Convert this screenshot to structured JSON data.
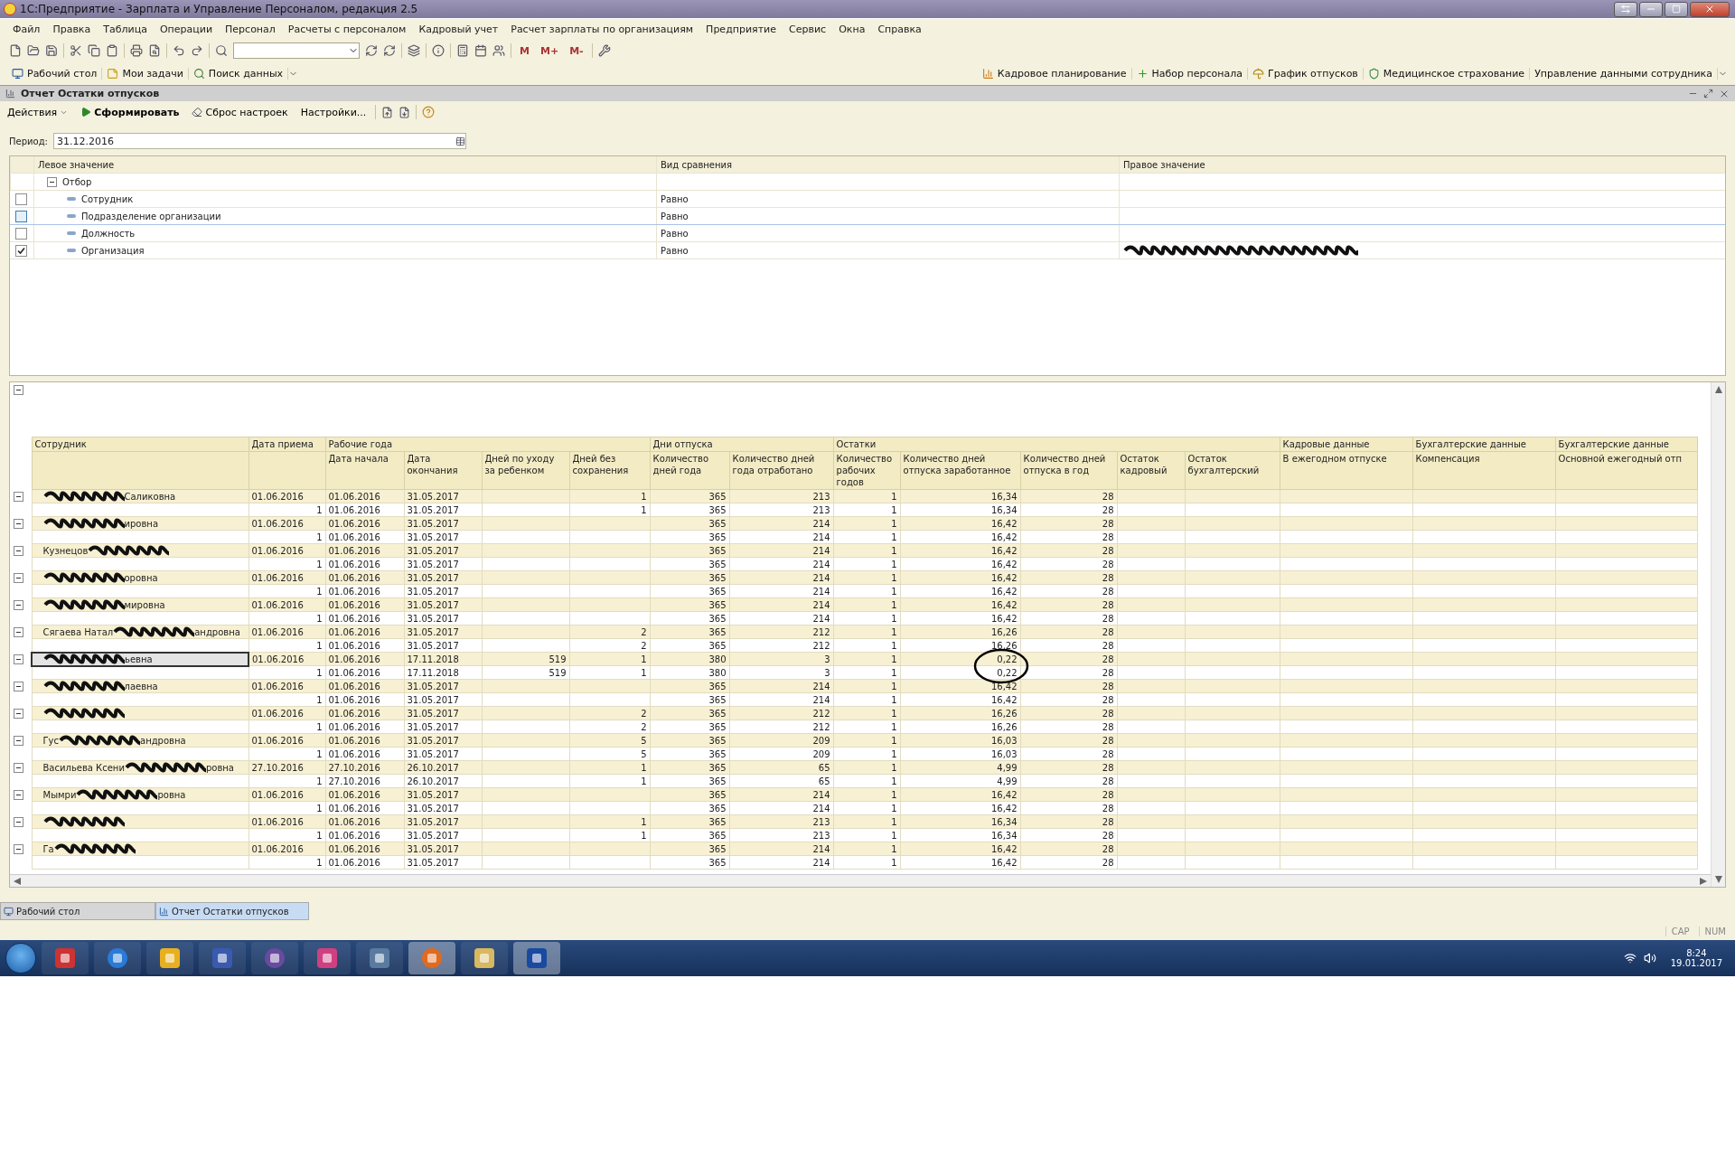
{
  "window": {
    "title": "1С:Предприятие - Зарплата и Управление Персоналом, редакция 2.5"
  },
  "menu": [
    "Файл",
    "Правка",
    "Таблица",
    "Операции",
    "Персонал",
    "Расчеты с персоналом",
    "Кадровый учет",
    "Расчет зарплаты по организациям",
    "Предприятие",
    "Сервис",
    "Окна",
    "Справка"
  ],
  "memory_buttons": [
    "M",
    "M+",
    "M-"
  ],
  "panel_left": [
    {
      "label": "Рабочий стол",
      "kind": "desk"
    },
    {
      "label": "Мои задачи",
      "kind": "note"
    },
    {
      "label": "Поиск данных",
      "kind": "search"
    }
  ],
  "panel_right": [
    {
      "label": "Кадровое планирование",
      "kind": "chart"
    },
    {
      "label": "Набор персонала",
      "kind": "plus"
    },
    {
      "label": "График отпусков",
      "kind": "umbrella"
    },
    {
      "label": "Медицинское страхование",
      "kind": "shield"
    },
    {
      "label": "Управление данными сотрудника",
      "kind": "none"
    }
  ],
  "document": {
    "title": "Отчет  Остатки отпусков",
    "actions": [
      {
        "label": "Действия",
        "kind": "menu"
      },
      {
        "label": "Сформировать",
        "kind": "run"
      },
      {
        "label": "Сброс настроек",
        "kind": "reset"
      },
      {
        "label": "Настройки...",
        "kind": "plain"
      }
    ],
    "period": {
      "label": "Период:",
      "value": "31.12.2016"
    },
    "filter": {
      "columns": [
        "Левое значение",
        "Вид сравнения",
        "Правое значение"
      ],
      "rows": [
        {
          "label": "Отбор",
          "expanded": true,
          "children": [
            {
              "label": "Сотрудник",
              "comparison": "Равно",
              "checked": false,
              "selected": false
            },
            {
              "label": "Подразделение организации",
              "comparison": "Равно",
              "checked": false,
              "selected": true
            },
            {
              "label": "Должность",
              "comparison": "Равно",
              "checked": false,
              "selected": false
            },
            {
              "label": "Организация",
              "comparison": "Равно",
              "checked": true,
              "selected": false,
              "redacted": true
            }
          ]
        }
      ]
    },
    "report": {
      "expanded": true,
      "columns": [
        {
          "label": "Сотрудник"
        },
        {
          "label": "Дата приема"
        },
        {
          "label": "Рабочие года",
          "sub": [
            "Дата начала",
            "Дата окончания",
            "Дней по уходу за ребенком",
            "Дней без сохранения"
          ]
        },
        {
          "label": "Дни отпуска",
          "sub": [
            "Количество дней года",
            "Количество дней года отработано"
          ]
        },
        {
          "label": "Остатки",
          "sub": [
            "Количество рабочих годов",
            "Количество дней отпуска заработанное",
            "Количество дней отпуска в год",
            "Остаток кадровый",
            "Остаток бухгалтерский"
          ]
        },
        {
          "label": "Кадровые данные",
          "sub": [
            "В ежегодном отпуске"
          ]
        },
        {
          "label": "Бухгалтерские данные",
          "sub": [
            "Компенсация"
          ]
        },
        {
          "label": "Бухгалтерские данные",
          "sub": [
            "Основной ежегодный отп"
          ]
        }
      ],
      "groups": [
        {
          "name_end": "Саликовна",
          "hired": "01.06.2016",
          "cells": {
            "start": "01.06.2016",
            "end": "31.05.2017",
            "unpaid": "1",
            "days_year": "365",
            "worked": "213",
            "years": "1",
            "earned": "16,34",
            "per_year": "28"
          },
          "sub_label": "1",
          "sub_cells": {
            "start": "01.06.2016",
            "end": "31.05.2017",
            "unpaid": "1",
            "days_year": "365",
            "worked": "213",
            "years": "1",
            "earned": "16,34",
            "per_year": "28"
          },
          "expanded": true,
          "selected": false
        },
        {
          "name_end": "ировна",
          "hired": "01.06.2016",
          "cells": {
            "start": "01.06.2016",
            "end": "31.05.2017",
            "days_year": "365",
            "worked": "214",
            "years": "1",
            "earned": "16,42",
            "per_year": "28"
          },
          "sub_label": "1",
          "sub_cells": {
            "start": "01.06.2016",
            "end": "31.05.2017",
            "days_year": "365",
            "worked": "214",
            "years": "1",
            "earned": "16,42",
            "per_year": "28"
          },
          "expanded": true,
          "selected": false
        },
        {
          "name_start": "Кузнецов",
          "hired": "01.06.2016",
          "cells": {
            "start": "01.06.2016",
            "end": "31.05.2017",
            "days_year": "365",
            "worked": "214",
            "years": "1",
            "earned": "16,42",
            "per_year": "28"
          },
          "sub_label": "1",
          "sub_cells": {
            "start": "01.06.2016",
            "end": "31.05.2017",
            "days_year": "365",
            "worked": "214",
            "years": "1",
            "earned": "16,42",
            "per_year": "28"
          },
          "expanded": true,
          "selected": false
        },
        {
          "name_end": "оровна",
          "hired": "01.06.2016",
          "cells": {
            "start": "01.06.2016",
            "end": "31.05.2017",
            "days_year": "365",
            "worked": "214",
            "years": "1",
            "earned": "16,42",
            "per_year": "28"
          },
          "sub_label": "1",
          "sub_cells": {
            "start": "01.06.2016",
            "end": "31.05.2017",
            "days_year": "365",
            "worked": "214",
            "years": "1",
            "earned": "16,42",
            "per_year": "28"
          },
          "expanded": true,
          "selected": false
        },
        {
          "name_end": "мировна",
          "hired": "01.06.2016",
          "cells": {
            "start": "01.06.2016",
            "end": "31.05.2017",
            "days_year": "365",
            "worked": "214",
            "years": "1",
            "earned": "16,42",
            "per_year": "28"
          },
          "sub_label": "1",
          "sub_cells": {
            "start": "01.06.2016",
            "end": "31.05.2017",
            "days_year": "365",
            "worked": "214",
            "years": "1",
            "earned": "16,42",
            "per_year": "28"
          },
          "expanded": true,
          "selected": false
        },
        {
          "name_start": "Сягаева Натал",
          "name_end": "андровна",
          "hired": "01.06.2016",
          "cells": {
            "start": "01.06.2016",
            "end": "31.05.2017",
            "unpaid": "2",
            "days_year": "365",
            "worked": "212",
            "years": "1",
            "earned": "16,26",
            "per_year": "28"
          },
          "sub_label": "1",
          "sub_cells": {
            "start": "01.06.2016",
            "end": "31.05.2017",
            "unpaid": "2",
            "days_year": "365",
            "worked": "212",
            "years": "1",
            "earned": "16,26",
            "per_year": "28"
          },
          "expanded": true,
          "selected": false
        },
        {
          "name_end": "ьевна",
          "hired": "01.06.2016",
          "cells": {
            "start": "01.06.2016",
            "end": "17.11.2018",
            "child_care": "519",
            "unpaid": "1",
            "days_year": "380",
            "worked": "3",
            "years": "1",
            "earned": "0,22",
            "per_year": "28"
          },
          "sub_label": "1",
          "sub_cells": {
            "start": "01.06.2016",
            "end": "17.11.2018",
            "child_care": "519",
            "unpaid": "1",
            "days_year": "380",
            "worked": "3",
            "years": "1",
            "earned": "0,22",
            "per_year": "28"
          },
          "expanded": true,
          "selected": true,
          "circled": true
        },
        {
          "name_end": "лаевна",
          "hired": "01.06.2016",
          "cells": {
            "start": "01.06.2016",
            "end": "31.05.2017",
            "days_year": "365",
            "worked": "214",
            "years": "1",
            "earned": "16,42",
            "per_year": "28"
          },
          "sub_label": "1",
          "sub_cells": {
            "start": "01.06.2016",
            "end": "31.05.2017",
            "days_year": "365",
            "worked": "214",
            "years": "1",
            "earned": "16,42",
            "per_year": "28"
          },
          "expanded": true,
          "selected": false
        },
        {
          "hired": "01.06.2016",
          "cells": {
            "start": "01.06.2016",
            "end": "31.05.2017",
            "unpaid": "2",
            "days_year": "365",
            "worked": "212",
            "years": "1",
            "earned": "16,26",
            "per_year": "28"
          },
          "sub_label": "1",
          "sub_cells": {
            "start": "01.06.2016",
            "end": "31.05.2017",
            "unpaid": "2",
            "days_year": "365",
            "worked": "212",
            "years": "1",
            "earned": "16,26",
            "per_year": "28"
          },
          "expanded": true,
          "selected": false
        },
        {
          "name_start": "Гус",
          "name_end": "андровна",
          "hired": "01.06.2016",
          "cells": {
            "start": "01.06.2016",
            "end": "31.05.2017",
            "unpaid": "5",
            "days_year": "365",
            "worked": "209",
            "years": "1",
            "earned": "16,03",
            "per_year": "28"
          },
          "sub_label": "1",
          "sub_cells": {
            "start": "01.06.2016",
            "end": "31.05.2017",
            "unpaid": "5",
            "days_year": "365",
            "worked": "209",
            "years": "1",
            "earned": "16,03",
            "per_year": "28"
          },
          "expanded": true,
          "selected": false
        },
        {
          "name_start": "Васильева Ксени",
          "name_end": "ровна",
          "hired": "27.10.2016",
          "cells": {
            "start": "27.10.2016",
            "end": "26.10.2017",
            "unpaid": "1",
            "days_year": "365",
            "worked": "65",
            "years": "1",
            "earned": "4,99",
            "per_year": "28"
          },
          "sub_label": "1",
          "sub_cells": {
            "start": "27.10.2016",
            "end": "26.10.2017",
            "unpaid": "1",
            "days_year": "365",
            "worked": "65",
            "years": "1",
            "earned": "4,99",
            "per_year": "28"
          },
          "expanded": true,
          "selected": false
        },
        {
          "name_start": "Мымри",
          "name_end": "ровна",
          "hired": "01.06.2016",
          "cells": {
            "start": "01.06.2016",
            "end": "31.05.2017",
            "days_year": "365",
            "worked": "214",
            "years": "1",
            "earned": "16,42",
            "per_year": "28"
          },
          "sub_label": "1",
          "sub_cells": {
            "start": "01.06.2016",
            "end": "31.05.2017",
            "days_year": "365",
            "worked": "214",
            "years": "1",
            "earned": "16,42",
            "per_year": "28"
          },
          "expanded": true,
          "selected": false
        },
        {
          "hired": "01.06.2016",
          "cells": {
            "start": "01.06.2016",
            "end": "31.05.2017",
            "unpaid": "1",
            "days_year": "365",
            "worked": "213",
            "years": "1",
            "earned": "16,34",
            "per_year": "28"
          },
          "sub_label": "1",
          "sub_cells": {
            "start": "01.06.2016",
            "end": "31.05.2017",
            "unpaid": "1",
            "days_year": "365",
            "worked": "213",
            "years": "1",
            "earned": "16,34",
            "per_year": "28"
          },
          "expanded": true,
          "selected": false
        },
        {
          "name_start": "Га",
          "hired": "01.06.2016",
          "cells": {
            "start": "01.06.2016",
            "end": "31.05.2017",
            "days_year": "365",
            "worked": "214",
            "years": "1",
            "earned": "16,42",
            "per_year": "28"
          },
          "sub_label": "1",
          "sub_cells": {
            "start": "01.06.2016",
            "end": "31.05.2017",
            "days_year": "365",
            "worked": "214",
            "years": "1",
            "earned": "16,42",
            "per_year": "28"
          },
          "expanded": true,
          "selected": false
        }
      ]
    }
  },
  "window_tabs": [
    {
      "label": "Рабочий стол",
      "selected": false
    },
    {
      "label": "Отчет  Остатки отпусков",
      "selected": true
    }
  ],
  "status_bar": [
    "CAP",
    "NUM"
  ],
  "taskbar": {
    "time": "8:24",
    "date": "19.01.2017"
  }
}
